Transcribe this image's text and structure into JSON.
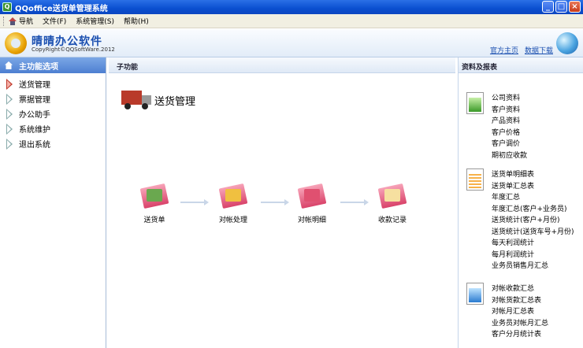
{
  "window": {
    "title": "QQoffice送货单管理系统",
    "minimize": "_",
    "maximize": "□",
    "close": "×"
  },
  "menu": {
    "items": [
      "导航",
      "文件(F)",
      "系统管理(S)",
      "帮助(H)"
    ]
  },
  "header": {
    "logo_name": "晴晴办公软件",
    "logo_copyright": "CopyRight©QQSoftWare.2012",
    "links": [
      "官方主页",
      "数据下载"
    ]
  },
  "left": {
    "title": "主功能选项",
    "items": [
      "送货管理",
      "票据管理",
      "办公助手",
      "系统维护",
      "退出系统"
    ],
    "active_index": 0
  },
  "middle": {
    "header": "子功能",
    "section_title": "送货管理",
    "flow": [
      "送货单",
      "对帐处理",
      "对帐明细",
      "收款记录"
    ]
  },
  "right": {
    "header": "资料及报表",
    "groups": [
      {
        "icon": "green-table-icon",
        "items": [
          "公司资料",
          "客户资料",
          "产品资料",
          "客户价格",
          "客户调价",
          "期初应收款"
        ]
      },
      {
        "icon": "orange-report-icon",
        "items": [
          "送货单明细表",
          "送货单汇总表",
          "年度汇总",
          "年度汇总(客户+业务员)",
          "送货统计(客户+月份)",
          "送货统计(送货车号+月份)",
          "每天利润统计",
          "每月利润统计",
          "业务员销售月汇总"
        ]
      },
      {
        "icon": "blue-report-icon",
        "items": [
          "对帐收款汇总",
          "对帐货款汇总表",
          "对帐月汇总表",
          "业务员对帐月汇总",
          "客户分月统计表"
        ]
      }
    ]
  },
  "colors": {
    "titlebar": "#0a4fd0",
    "accent": "#4d7fd1",
    "active_marker": "#c0392b"
  }
}
